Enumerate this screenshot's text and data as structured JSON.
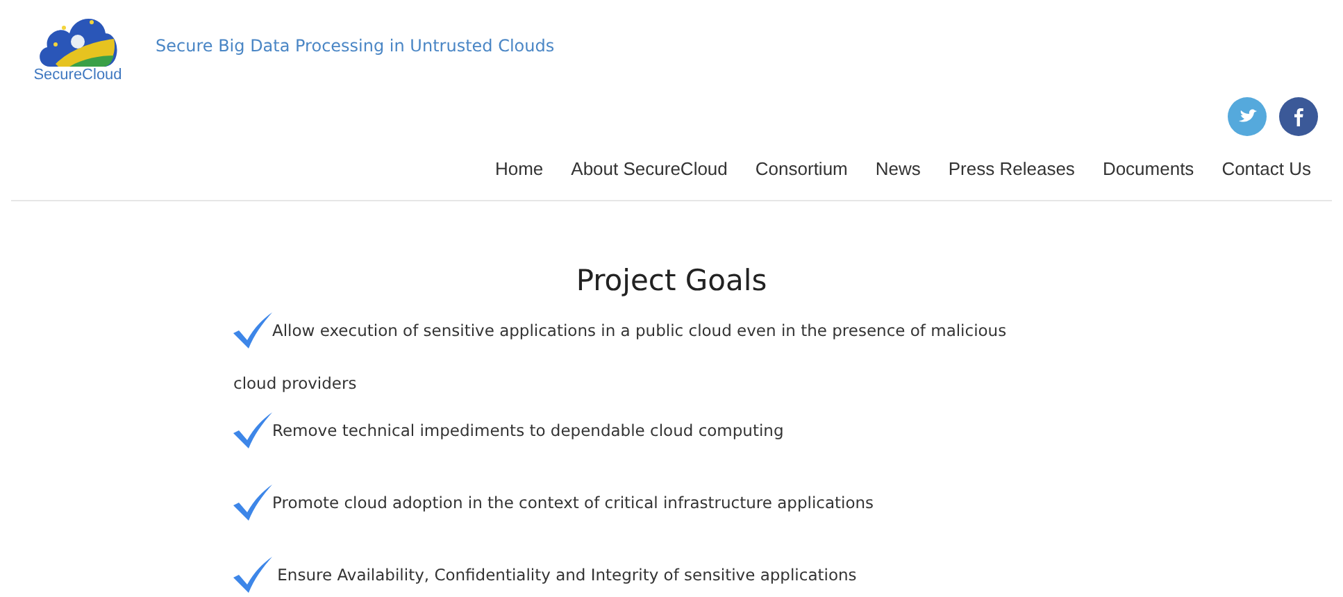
{
  "header": {
    "logo_text": "SecureCloud",
    "tagline": "Secure Big Data Processing in Untrusted Clouds"
  },
  "nav": [
    {
      "label": "Home"
    },
    {
      "label": "About SecureCloud"
    },
    {
      "label": "Consortium"
    },
    {
      "label": "News"
    },
    {
      "label": "Press Releases"
    },
    {
      "label": "Documents"
    },
    {
      "label": "Contact Us"
    }
  ],
  "content": {
    "title": "Project Goals",
    "goals": [
      "Allow execution of sensitive applications in a public cloud even in the presence of malicious cloud providers",
      "Remove technical impediments to dependable cloud computing",
      "Promote cloud adoption in the context of critical infrastructure applications",
      " Ensure Availability, Confidentiality and Integrity of sensitive applications"
    ]
  }
}
